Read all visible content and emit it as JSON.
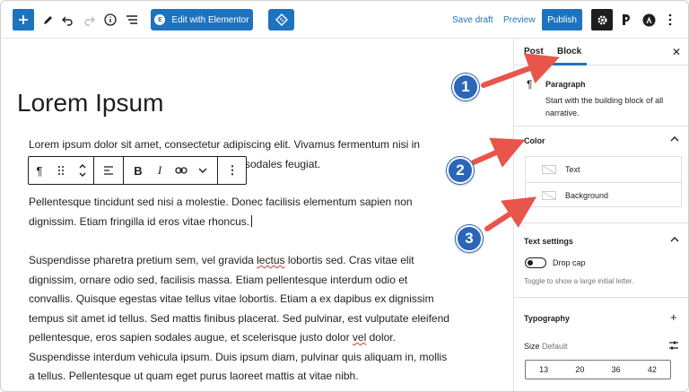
{
  "toolbar": {
    "elementor_label": "Edit with Elementor",
    "elementor_badge": "E",
    "save_draft": "Save draft",
    "preview": "Preview",
    "publish": "Publish"
  },
  "editor": {
    "title": "Lorem Ipsum",
    "paragraphs": [
      "Lorem ipsum dolor sit amet, consectetur adipiscing elit. Vivamus fermentum nisi in",
      "sodales feugiat.",
      "Pellentesque tincidunt sed nisi a molestie. Donec facilisis elementum sapien non",
      "dignissim. Etiam fringilla id eros vitae rhoncus.",
      "Suspendisse pharetra pretium sem, vel gravida",
      "lectus",
      "lobortis sed. Cras vitae elit",
      "dignissim, ornare odio sed, facilisis massa. Etiam pellentesque interdum odio et",
      "convallis. Quisque egestas vitae tellus vitae lobortis. Etiam a ex dapibus ex dignissim",
      "tempus sit amet id tellus. Sed mattis finibus placerat. Sed pulvinar, est vulputate eleifend",
      "pellentesque, eros sapien sodales augue, et scelerisque justo dolor",
      "vel",
      "dolor.",
      "Suspendisse interdum vehicula ipsum. Duis ipsum diam, pulvinar quis aliquam in, mollis",
      "a tellus. Pellentesque ut quam eget purus laoreet mattis at vitae nibh."
    ]
  },
  "block_toolbar": {
    "pilcrow": "¶",
    "bold": "B",
    "italic": "I",
    "more": "⋮"
  },
  "sidebar": {
    "tabs": [
      "Post",
      "Block"
    ],
    "active_tab": "Block",
    "close": "✕",
    "block": {
      "icon": "¶",
      "name": "Paragraph",
      "description": "Start with the building block of all narrative."
    },
    "color": {
      "heading": "Color",
      "items": [
        "Text",
        "Background"
      ]
    },
    "text_settings": {
      "heading": "Text settings",
      "drop_cap_label": "Drop cap",
      "drop_cap_help": "Toggle to show a large initial letter.",
      "drop_cap_enabled": false
    },
    "typography": {
      "heading": "Typography",
      "plus": "+",
      "size_label": "Size",
      "size_value": "Default",
      "sizes": [
        "13",
        "20",
        "36",
        "42"
      ]
    }
  },
  "annotations": {
    "callouts": [
      "1",
      "2",
      "3"
    ],
    "arrow_color": "#e8554a",
    "callout_color": "#2b66b8"
  },
  "colors": {
    "accent": "#1e73be",
    "text": "#1e1e1e"
  }
}
